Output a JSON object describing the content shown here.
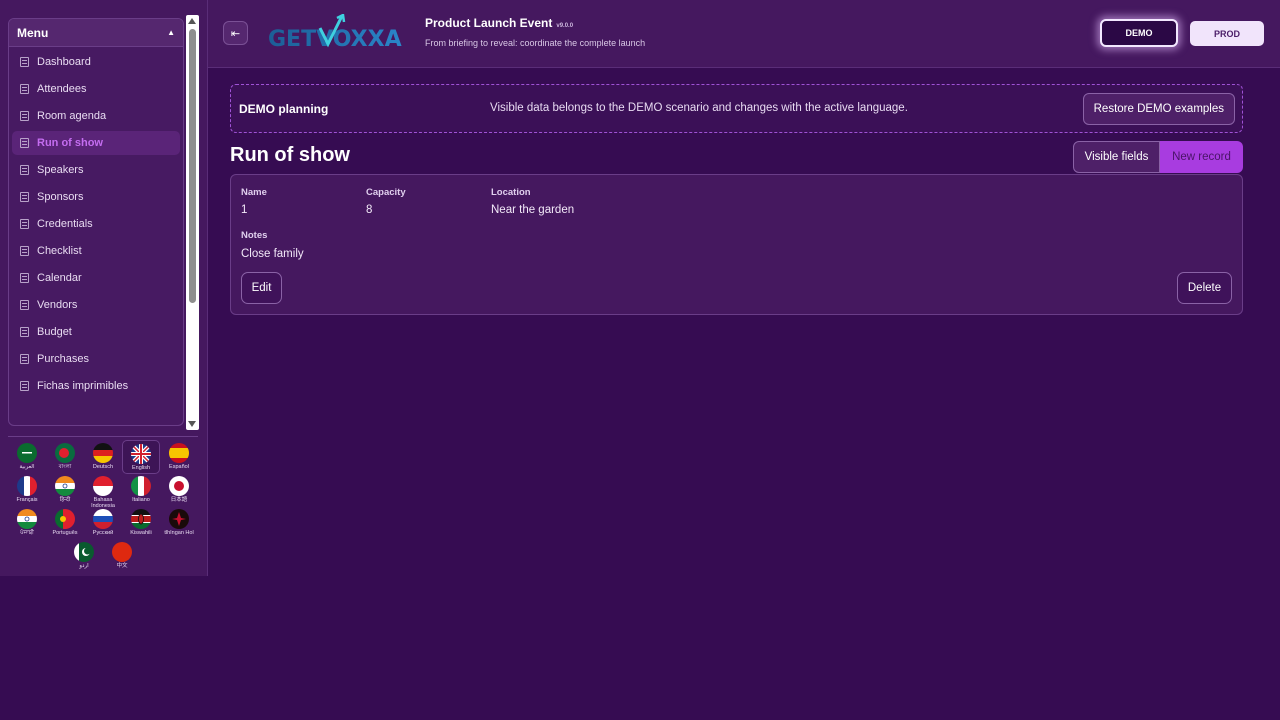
{
  "sidebar": {
    "menu_title": "Menu",
    "items": [
      {
        "label": "Dashboard",
        "icon": "document-icon"
      },
      {
        "label": "Attendees",
        "icon": "document-icon"
      },
      {
        "label": "Room agenda",
        "icon": "document-icon"
      },
      {
        "label": "Run of show",
        "icon": "document-icon",
        "active": true
      },
      {
        "label": "Speakers",
        "icon": "document-icon"
      },
      {
        "label": "Sponsors",
        "icon": "document-icon"
      },
      {
        "label": "Credentials",
        "icon": "document-icon"
      },
      {
        "label": "Checklist",
        "icon": "document-icon"
      },
      {
        "label": "Calendar",
        "icon": "document-icon"
      },
      {
        "label": "Vendors",
        "icon": "document-icon"
      },
      {
        "label": "Budget",
        "icon": "document-icon"
      },
      {
        "label": "Purchases",
        "icon": "document-icon"
      },
      {
        "label": "Fichas imprimibles",
        "icon": "document-icon"
      }
    ],
    "languages": [
      {
        "label": "العربية",
        "flag": "saudi-arabia-flag"
      },
      {
        "label": "বাংলা",
        "flag": "bangladesh-flag"
      },
      {
        "label": "Deutsch",
        "flag": "germany-flag"
      },
      {
        "label": "English",
        "flag": "uk-flag",
        "selected": true
      },
      {
        "label": "Español",
        "flag": "spain-flag"
      },
      {
        "label": "Français",
        "flag": "france-flag"
      },
      {
        "label": "हिन्दी",
        "flag": "india-flag"
      },
      {
        "label": "Bahasa Indonesia",
        "flag": "indonesia-flag"
      },
      {
        "label": "Italiano",
        "flag": "italy-flag"
      },
      {
        "label": "日本語",
        "flag": "japan-flag"
      },
      {
        "label": "ਪੰਜਾਬੀ",
        "flag": "india-flag"
      },
      {
        "label": "Português",
        "flag": "portugal-flag"
      },
      {
        "label": "Русский",
        "flag": "russia-flag"
      },
      {
        "label": "Kiswahili",
        "flag": "kenya-flag"
      },
      {
        "label": "tlhIngan Hol",
        "flag": "klingon-flag"
      },
      {
        "label": "اردو",
        "flag": "pakistan-flag"
      },
      {
        "label": "中文",
        "flag": "china-flag"
      }
    ]
  },
  "header": {
    "logo_text": "GETVOXXA",
    "event_title": "Product Launch Event",
    "version": "v9.0.0",
    "subtitle": "From briefing to reveal: coordinate the complete launch",
    "env_demo": "DEMO",
    "env_prod": "PROD"
  },
  "scenario": {
    "title": "DEMO planning",
    "description": "Visible data belongs to the DEMO scenario and changes with the active language.",
    "restore_label": "Restore DEMO examples"
  },
  "main": {
    "page_title": "Run of show",
    "visible_fields_label": "Visible fields",
    "new_record_label": "New record",
    "record": {
      "name_label": "Name",
      "name_value": "1",
      "capacity_label": "Capacity",
      "capacity_value": "8",
      "location_label": "Location",
      "location_value": "Near the garden",
      "notes_label": "Notes",
      "notes_value": "Close family",
      "edit_label": "Edit",
      "delete_label": "Delete"
    }
  },
  "colors": {
    "background": "#360c52",
    "panel": "#45185f",
    "accent": "#a83ce0",
    "active_text": "#c46df0"
  }
}
